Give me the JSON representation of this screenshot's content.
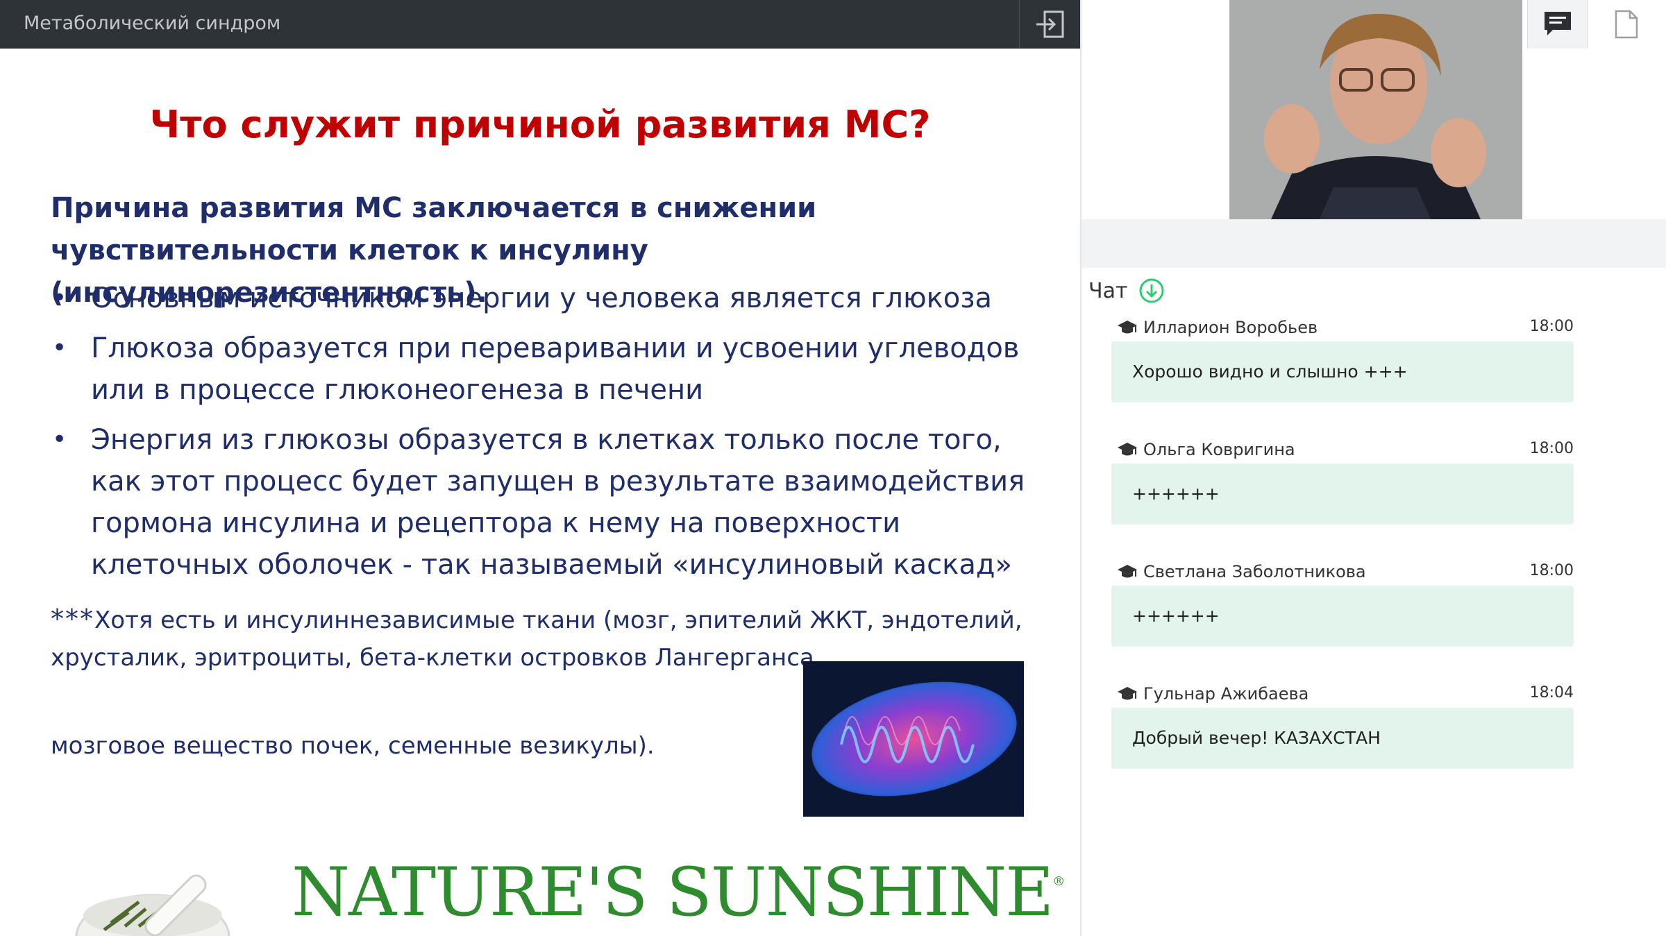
{
  "topbar": {
    "title": "Метаболический синдром",
    "exit_icon": "exit-icon"
  },
  "slide": {
    "title": "Что служит причиной развития МС?",
    "lead_line1": "Причина развития МС заключается в снижении",
    "lead_line2": "чувствительности клеток к инсулину (инсулинорезистентность).",
    "bullets": [
      {
        "lines": [
          "Основным источником энергии у человека является глюкоза"
        ]
      },
      {
        "lines": [
          "Глюкоза образуется при переваривании и усвоении углеводов",
          "или в процессе глюконеогенеза в печени"
        ]
      },
      {
        "lines": [
          "Энергия из глюкозы образуется в клетках только после того,",
          "как этот процесс будет запущен в результате взаимодействия",
          "гормона инсулина и рецептора к нему на поверхности",
          "клеточных оболочек - так называемый «инсулиновый каскад»"
        ]
      }
    ],
    "note_stars": "***",
    "note_line1": "Хотя есть и инсулиннезависимые ткани (мозг, эпителий ЖКТ, эндотелий,",
    "note_line2": "хрусталик, эритроциты, бета-клетки островков Лангерганса,",
    "note_line3": "мозговое вещество почек, семенные везикулы).",
    "brand_name": "NATURE'S SUNSHINE",
    "brand_mark": "®"
  },
  "toolbar": {
    "chat_icon": "chat-bubble-icon",
    "files_icon": "document-icon"
  },
  "chat": {
    "header": "Чат",
    "scroll_icon": "arrow-down-circle-icon",
    "accent": "#2ecc71",
    "bubble_color": "#e2f4ec",
    "messages": [
      {
        "author": "Илларион Воробьев",
        "time": "18:00",
        "text": "Хорошо видно и слышно +++"
      },
      {
        "author": "Ольга Ковригина",
        "time": "18:00",
        "text": "++++++"
      },
      {
        "author": "Светлана Заболотникова",
        "time": "18:00",
        "text": "++++++"
      },
      {
        "author": "Гульнар Ажибаева",
        "time": "18:04",
        "text": "Добрый вечер! КАЗАХСТАН"
      }
    ]
  }
}
